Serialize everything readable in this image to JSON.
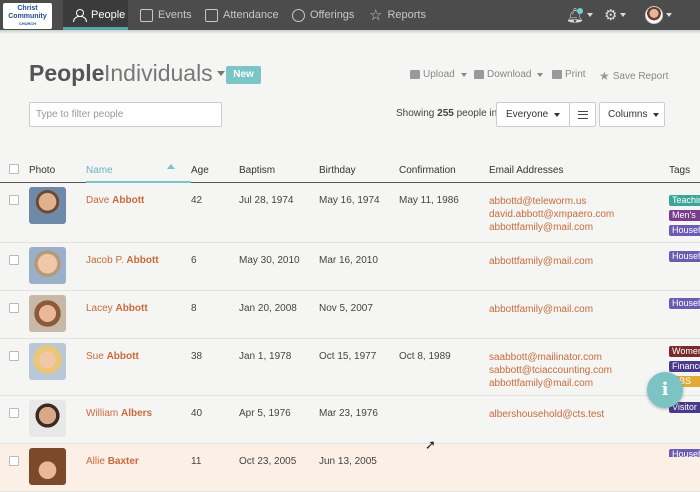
{
  "nav": {
    "logo": {
      "line1": "Christ",
      "line2": "Community",
      "line3": "CHURCH"
    },
    "items": [
      {
        "label": "People",
        "icon": "person-icon",
        "active": true
      },
      {
        "label": "Events",
        "icon": "calendar-icon"
      },
      {
        "label": "Attendance",
        "icon": "checkbox-icon"
      },
      {
        "label": "Offerings",
        "icon": "dollar-circle-icon"
      },
      {
        "label": "Reports",
        "icon": "star-icon"
      }
    ],
    "right": [
      "bell-icon",
      "gear-icon",
      "user-avatar"
    ]
  },
  "page": {
    "title": "People",
    "subtitle": "Individuals",
    "new_label": "New"
  },
  "actions": {
    "upload": "Upload",
    "download": "Download",
    "print": "Print",
    "save_report": "Save Report"
  },
  "filter": {
    "placeholder": "Type to filter people"
  },
  "showing": {
    "prefix": "Showing",
    "count": "255",
    "suffix": "people in"
  },
  "segment": {
    "everyone": "Everyone",
    "columns": "Columns"
  },
  "table": {
    "headers": [
      "Photo",
      "Name",
      "Age",
      "Baptism",
      "Birthday",
      "Confirmation",
      "Email Addresses",
      "Tags"
    ],
    "rows": [
      {
        "first": "Dave",
        "last": "Abbott",
        "age": "42",
        "baptism": "Jul 28, 1974",
        "birthday": "May 16, 1974",
        "confirmation": "May 11, 1986",
        "emails": [
          "abbottd@teleworm.us",
          "david.abbott@xmpaero.com",
          "abbottfamily@mail.com"
        ],
        "tags": [
          {
            "label": "Teaching",
            "color": "#3aa69a"
          },
          {
            "label": "Men's",
            "color": "#7a3c8c"
          },
          {
            "label": "Household",
            "color": "#6c5bb3"
          }
        ]
      },
      {
        "first": "Jacob P.",
        "last": "Abbott",
        "age": "6",
        "baptism": "May 30, 2010",
        "birthday": "Mar 16, 2010",
        "confirmation": "",
        "emails": [
          "abbottfamily@mail.com"
        ],
        "tags": [
          {
            "label": "Household",
            "color": "#6c5bb3"
          }
        ]
      },
      {
        "first": "Lacey",
        "last": "Abbott",
        "age": "8",
        "baptism": "Jan 20, 2008",
        "birthday": "Nov 5, 2007",
        "confirmation": "",
        "emails": [
          "abbottfamily@mail.com"
        ],
        "tags": [
          {
            "label": "Household",
            "color": "#6c5bb3"
          }
        ]
      },
      {
        "first": "Sue",
        "last": "Abbott",
        "age": "38",
        "baptism": "Jan 1, 1978",
        "birthday": "Oct 15, 1977",
        "confirmation": "Oct 8, 1989",
        "emails": [
          "saabbott@mailinator.com",
          "sabbott@tciaccounting.com",
          "abbottfamily@mail.com"
        ],
        "tags": [
          {
            "label": "Women's",
            "color": "#7a2a2a"
          },
          {
            "label": "Finance",
            "color": "#4a3a8c"
          },
          {
            "label": "OBS",
            "color": "#e0a93a"
          }
        ]
      },
      {
        "first": "William",
        "last": "Albers",
        "age": "40",
        "baptism": "Apr 5, 1976",
        "birthday": "Mar 23, 1976",
        "confirmation": "",
        "emails": [
          "albershousehold@cts.test"
        ],
        "tags": [
          {
            "label": "Visitor",
            "color": "#4a3a8c"
          }
        ]
      },
      {
        "first": "Allie",
        "last": "Baxter",
        "age": "11",
        "baptism": "Oct 23, 2005",
        "birthday": "Jun 13, 2005",
        "confirmation": "",
        "emails": [],
        "tags": [
          {
            "label": "Household",
            "color": "#6c5bb3"
          }
        ]
      }
    ]
  }
}
